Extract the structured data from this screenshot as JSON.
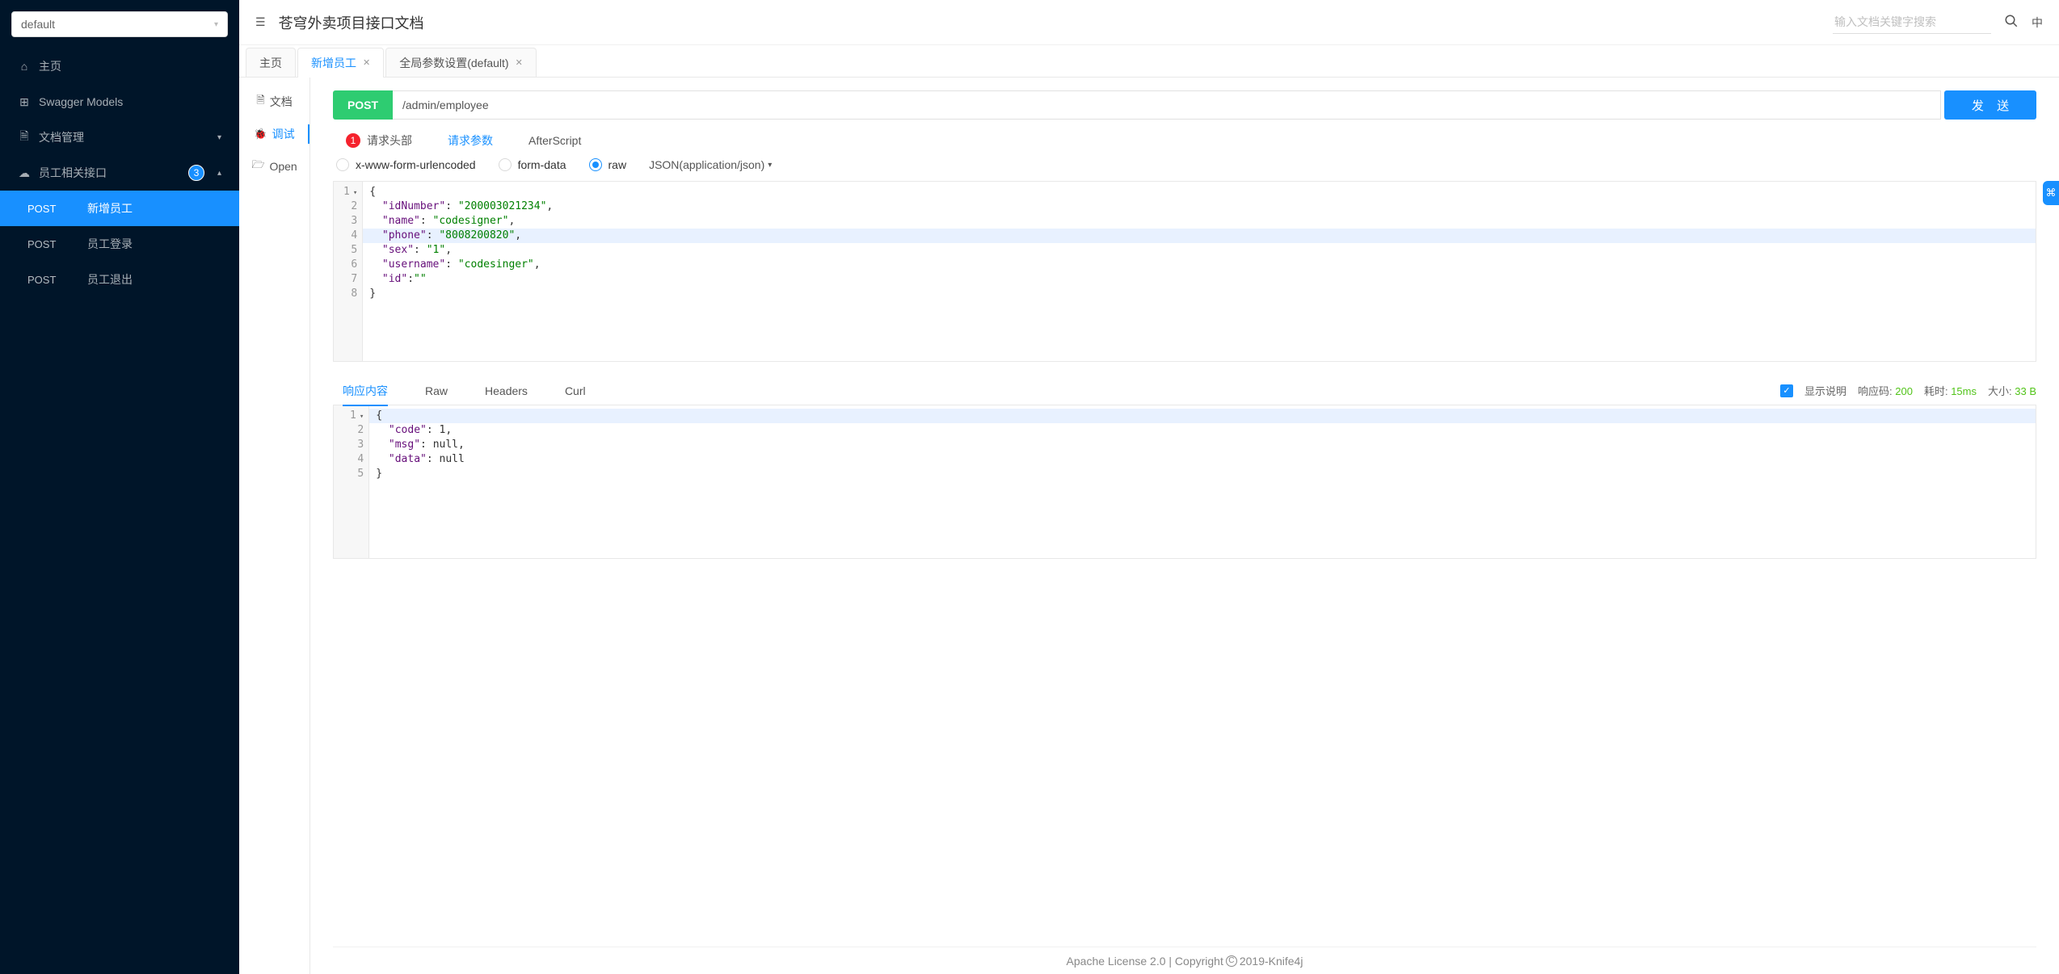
{
  "sidebar": {
    "project": "default",
    "nav": [
      {
        "icon": "⌂",
        "label": "主页"
      },
      {
        "icon": "⊞",
        "label": "Swagger Models"
      },
      {
        "icon": "🗎",
        "label": "文档管理",
        "expandable": true
      },
      {
        "icon": "☁",
        "label": "员工相关接口",
        "badge": "3",
        "expanded": true
      }
    ],
    "apis": [
      {
        "method": "POST",
        "name": "新增员工",
        "active": true
      },
      {
        "method": "POST",
        "name": "员工登录"
      },
      {
        "method": "POST",
        "name": "员工退出"
      }
    ]
  },
  "header": {
    "toggle_icon": "☰",
    "title": "苍穹外卖项目接口文档",
    "search_placeholder": "输入文档关键字搜索",
    "lang": "中"
  },
  "tabs": [
    {
      "label": "主页",
      "closable": false
    },
    {
      "label": "新增员工",
      "closable": true,
      "active": true
    },
    {
      "label": "全局参数设置(default)",
      "closable": true
    }
  ],
  "miniNav": [
    {
      "icon": "🗎",
      "label": "文档"
    },
    {
      "icon": "🐞",
      "label": "调试",
      "active": true
    },
    {
      "icon": "🗁",
      "label": "Open"
    }
  ],
  "request": {
    "method": "POST",
    "url": "/admin/employee",
    "send_label": "发 送",
    "subtabs": {
      "header": {
        "label": "请求头部",
        "badge": "1"
      },
      "params": {
        "label": "请求参数",
        "active": true
      },
      "after": {
        "label": "AfterScript"
      }
    },
    "body_types": {
      "urlencoded": "x-www-form-urlencoded",
      "formdata": "form-data",
      "raw": "raw",
      "selected": "raw",
      "content_type": "JSON(application/json)"
    },
    "body_json": {
      "idNumber": "200003021234",
      "name": "codesigner",
      "phone": "8008200820",
      "sex": "1",
      "username": "codesinger",
      "id": ""
    },
    "highlight_line": 4
  },
  "response": {
    "tabs": [
      {
        "label": "响应内容",
        "active": true
      },
      {
        "label": "Raw"
      },
      {
        "label": "Headers"
      },
      {
        "label": "Curl"
      }
    ],
    "show_desc_label": "显示说明",
    "code_label": "响应码:",
    "code": "200",
    "time_label": "耗时:",
    "time": "15ms",
    "size_label": "大小:",
    "size": "33 B",
    "body": {
      "code": 1,
      "msg": null,
      "data": null
    },
    "highlight_line": 1
  },
  "footer": {
    "text_left": "Apache License 2.0 | Copyright ",
    "text_right": " 2019-Knife4j"
  },
  "right_handle": "⌘"
}
